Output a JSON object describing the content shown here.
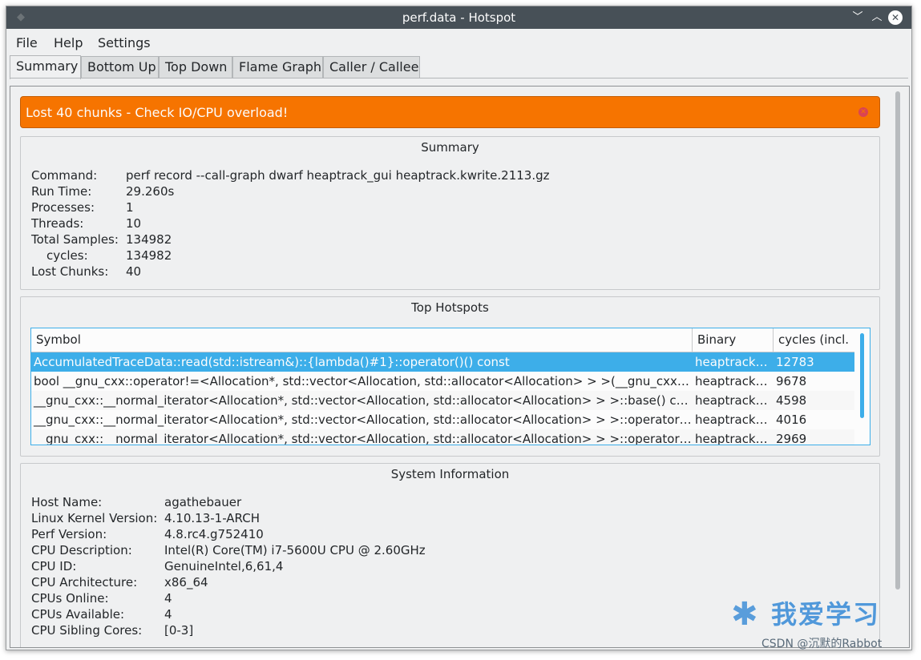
{
  "window": {
    "title": "perf.data - Hotspot",
    "min_glyph": "﹀",
    "max_glyph": "︿",
    "close_glyph": "✕"
  },
  "menu": [
    "File",
    "Help",
    "Settings"
  ],
  "tabs": [
    "Summary",
    "Bottom Up",
    "Top Down",
    "Flame Graph",
    "Caller / Callee"
  ],
  "warning": {
    "message": "Lost 40 chunks - Check IO/CPU overload!",
    "color": "#f67400"
  },
  "summary": {
    "title": "Summary",
    "rows": [
      {
        "key": "Command:",
        "value": "perf record --call-graph dwarf heaptrack_gui heaptrack.kwrite.2113.gz"
      },
      {
        "key": "Run Time:",
        "value": "29.260s"
      },
      {
        "key": "Processes:",
        "value": "1"
      },
      {
        "key": "Threads:",
        "value": "10"
      },
      {
        "key": "Total Samples:",
        "value": "134982"
      },
      {
        "key": "cycles:",
        "value": "134982"
      },
      {
        "key": "Lost Chunks:",
        "value": "40"
      }
    ]
  },
  "hotspots": {
    "title": "Top Hotspots",
    "columns": [
      "Symbol",
      "Binary",
      "cycles (incl."
    ],
    "rows": [
      {
        "symbol": "AccumulatedTraceData::read(std::istream&)::{lambda()#1}::operator()() const",
        "binary": "heaptrack_gui",
        "cost": "12783"
      },
      {
        "symbol": "bool __gnu_cxx::operator!=<Allocation*, std::vector<Allocation, std::allocator<Allocation> > >(__gnu_cxx::__normal_iterator",
        "binary": "heaptrack_gui",
        "cost": "9678"
      },
      {
        "symbol": "__gnu_cxx::__normal_iterator<Allocation*, std::vector<Allocation, std::allocator<Allocation> > >::base() const",
        "binary": "heaptrack_gui",
        "cost": "4598"
      },
      {
        "symbol": "__gnu_cxx::__normal_iterator<Allocation*, std::vector<Allocation, std::allocator<Allocation> > >::operator++()",
        "binary": "heaptrack_gui",
        "cost": "4016"
      },
      {
        "symbol": "__gnu_cxx::__normal_iterator<Allocation*, std::vector<Allocation, std::allocator<Allocation> > >::operator*() const",
        "binary": "heaptrack_gui",
        "cost": "2969"
      }
    ]
  },
  "sysinfo": {
    "title": "System Information",
    "rows": [
      {
        "key": "Host Name:",
        "value": "agathebauer"
      },
      {
        "key": "Linux Kernel Version:",
        "value": "4.10.13-1-ARCH"
      },
      {
        "key": "Perf Version:",
        "value": "4.8.rc4.g752410"
      },
      {
        "key": "CPU Description:",
        "value": "Intel(R) Core(TM) i7-5600U CPU @ 2.60GHz"
      },
      {
        "key": "CPU ID:",
        "value": "GenuineIntel,6,61,4"
      },
      {
        "key": "CPU Architecture:",
        "value": "x86_64"
      },
      {
        "key": "CPUs Online:",
        "value": "4"
      },
      {
        "key": "CPUs Available:",
        "value": "4"
      },
      {
        "key": "CPU Sibling Cores:",
        "value": "[0-3]"
      }
    ]
  },
  "watermark": {
    "main": "我爱学习",
    "sub": "CSDN @沉默的Rabbot"
  },
  "colors": {
    "titlebar": "#475057",
    "selection": "#3daee9",
    "background": "#eff0f1"
  }
}
